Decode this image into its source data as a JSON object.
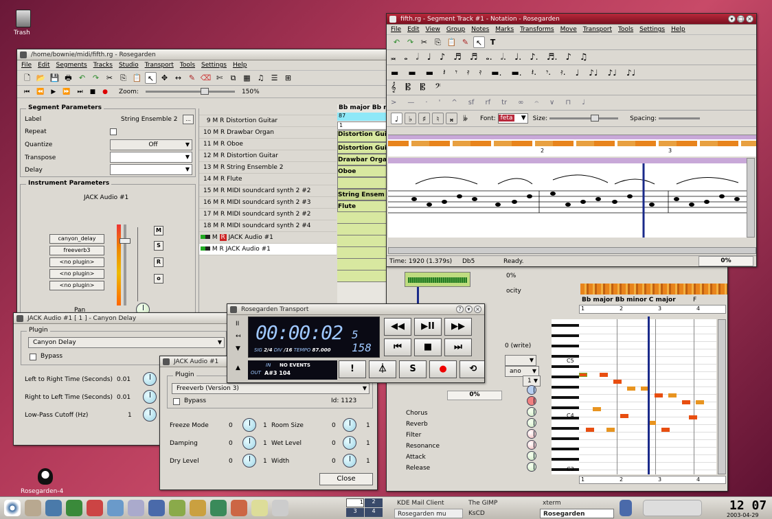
{
  "desktop": {
    "trash_label": "Trash",
    "rg_label": "Rosegarden-4"
  },
  "main_window": {
    "title": "/home/bownie/midi/fifth.rg - Rosegarden",
    "menu": [
      "File",
      "Edit",
      "Segments",
      "Tracks",
      "Studio",
      "Transport",
      "Tools",
      "Settings",
      "Help"
    ],
    "zoom_label": "Zoom:",
    "zoom_value": "150%",
    "segment_params": {
      "header": "Segment Parameters",
      "label_label": "Label",
      "label_value": "String Ensemble 2",
      "label_btn": "...",
      "repeat_label": "Repeat",
      "quantize_label": "Quantize",
      "quantize_value": "Off",
      "transpose_label": "Transpose",
      "delay_label": "Delay"
    },
    "instrument_params": {
      "header": "Instrument Parameters",
      "name": "JACK Audio #1",
      "plugins": [
        "canyon_delay",
        "freeverb3",
        "<no plugin>",
        "<no plugin>",
        "<no plugin>"
      ],
      "mute_btn": "M",
      "solo_btn": "S",
      "record_btn": "R",
      "pan_label": "Pan"
    },
    "tracks": [
      {
        "num": "9",
        "label": "Distortion Guitar"
      },
      {
        "num": "10",
        "label": "Drawbar Organ"
      },
      {
        "num": "11",
        "label": "Oboe"
      },
      {
        "num": "12",
        "label": "Distortion Guitar"
      },
      {
        "num": "13",
        "label": "String Ensemble 2"
      },
      {
        "num": "14",
        "label": "Flute"
      },
      {
        "num": "15",
        "label": "MIDI soundcard synth 2 #2"
      },
      {
        "num": "16",
        "label": "MIDI soundcard synth 2 #3"
      },
      {
        "num": "17",
        "label": "MIDI soundcard synth 2 #2"
      },
      {
        "num": "18",
        "label": "MIDI soundcard synth 2 #4"
      }
    ],
    "audio_tracks": [
      "JACK Audio #1",
      "JACK Audio #1"
    ],
    "track_letters": {
      "m": "M",
      "r": "R"
    },
    "ruler": {
      "key": "Bb major Bb r",
      "tempo": "87",
      "bar": "1"
    },
    "segments": [
      "Distortion Gui",
      "Distortion Gui",
      "Drawbar Orga",
      "Oboe",
      "String Ensem",
      "Flute"
    ]
  },
  "notation_window": {
    "title": "fifth.rg - Segment Track #1 - Notation - Rosegarden",
    "menu": [
      "File",
      "Edit",
      "View",
      "Group",
      "Notes",
      "Marks",
      "Transforms",
      "Move",
      "Transport",
      "Tools",
      "Settings",
      "Help"
    ],
    "font_label": "Font:",
    "font_value": "feta",
    "size_label": "Size:",
    "spacing_label": "Spacing:",
    "bar_numbers": [
      "2",
      "3"
    ],
    "status": {
      "time": "Time: 1920 (1.379s)",
      "note": "Db5",
      "state": "Ready.",
      "progress": "0%"
    }
  },
  "matrix_window": {
    "key_ruler": "Bb major Bb minor C major",
    "key_f": "F",
    "bars": [
      "1",
      "2",
      "3",
      "4"
    ],
    "notes_labels": {
      "c5": "C5",
      "c4": "C4",
      "c3": "C3"
    },
    "progress": "0%",
    "write_label": "0 (write)",
    "combo_value": "ano",
    "combo_num": "1",
    "velocity_label": "ocity",
    "pct": "0%",
    "controllers": [
      "Chorus",
      "Reverb",
      "Filter",
      "Resonance",
      "Attack",
      "Release"
    ]
  },
  "canyon_window": {
    "title": "JACK Audio #1 [ 1 ] - Canyon Delay",
    "plugin_header": "Plugin",
    "plugin_value": "Canyon Delay",
    "bypass_label": "Bypass",
    "params": [
      {
        "label": "Left to Right Time (Seconds)",
        "min": "0.01"
      },
      {
        "label": "Right to Left Time (Seconds)",
        "min": "0.01"
      },
      {
        "label": "Low-Pass Cutoff (Hz)",
        "min": "1"
      }
    ]
  },
  "freeverb_window": {
    "title": "JACK Audio #1",
    "plugin_header": "Plugin",
    "plugin_value": "Freeverb (Version 3)",
    "bypass_label": "Bypass",
    "id_label": "Id: 1123",
    "params": [
      {
        "label": "Freeze Mode",
        "min": "0",
        "max": "1",
        "label2": "Room Size",
        "min2": "0",
        "max2": "1"
      },
      {
        "label": "Damping",
        "min": "0",
        "max": "1",
        "label2": "Wet Level",
        "min2": "0",
        "max2": "1"
      },
      {
        "label": "Dry Level",
        "min": "0",
        "max": "1",
        "label2": "Width",
        "min2": "0",
        "max2": "1"
      }
    ],
    "close_label": "Close"
  },
  "transport_window": {
    "title": "Rosegarden Transport",
    "time": "00:00:02",
    "time_small": "5 158",
    "sig_label": "SIG",
    "sig": "2/4",
    "div_label": "DIV",
    "div": "/16",
    "tempo_label": "TEMPO",
    "tempo": "87.000",
    "in_label": "IN",
    "in_value": "NO EVENTS",
    "out_label": "OUT",
    "out_value": "A#3 104"
  },
  "taskbar": {
    "pager": [
      "1",
      "2",
      "3",
      "4"
    ],
    "tasks": [
      "KDE Mail Client",
      "Rosegarden mu",
      "The GIMP",
      "KsCD",
      "xterm",
      "Rosegarden"
    ],
    "clock": "12 07",
    "date": "2003-04-29"
  },
  "colors": {
    "accent": "#b8283a",
    "segment": "#d8e8a0",
    "lcd": "#0a0a14",
    "note_orange": "#e8841c"
  }
}
